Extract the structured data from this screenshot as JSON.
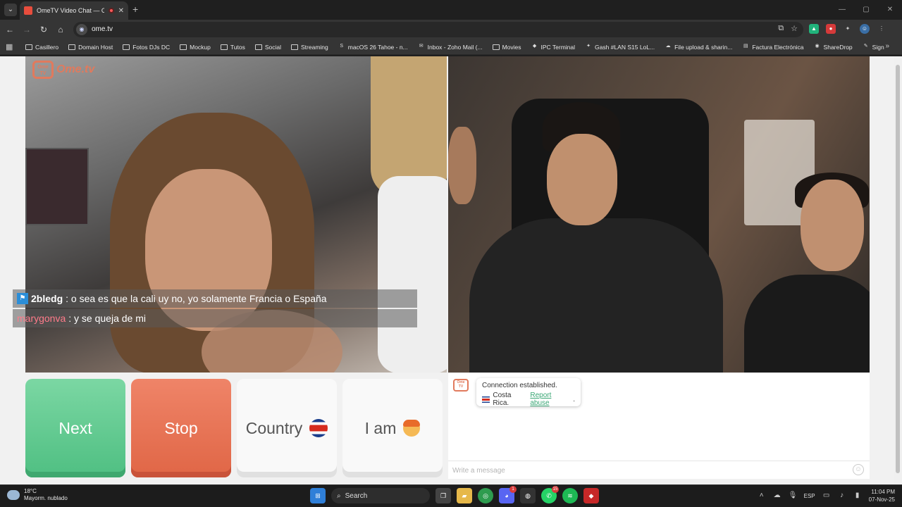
{
  "browser": {
    "tab_title": "OmeTV Video Chat — Ome",
    "url": "ome.tv",
    "window_controls": [
      "—",
      "▢",
      "✕"
    ]
  },
  "bookmarks": [
    {
      "label": "Casillero",
      "icon": "folder-icon"
    },
    {
      "label": "Domain Host",
      "icon": "folder-icon"
    },
    {
      "label": "Fotos DJs DC",
      "icon": "folder-icon"
    },
    {
      "label": "Mockup",
      "icon": "folder-icon"
    },
    {
      "label": "Tutos",
      "icon": "folder-icon"
    },
    {
      "label": "Social",
      "icon": "folder-icon"
    },
    {
      "label": "Streaming",
      "icon": "folder-icon"
    },
    {
      "label": "macOS 26 Tahoe - n...",
      "icon": "s-icon"
    },
    {
      "label": "Inbox - Zoho Mail (...",
      "icon": "mail-icon"
    },
    {
      "label": "Movies",
      "icon": "folder-icon"
    },
    {
      "label": "IPC Terminal",
      "icon": "shield-icon"
    },
    {
      "label": "Gash #LAN S15 LoL...",
      "icon": "game-icon"
    },
    {
      "label": "File upload & sharin...",
      "icon": "cloud-icon"
    },
    {
      "label": "Factura Electrónica",
      "icon": "doc-icon"
    },
    {
      "label": "ShareDrop",
      "icon": "drop-icon"
    },
    {
      "label": "Sign",
      "icon": "sign-icon"
    }
  ],
  "site": {
    "logo_text": "Ome.tv",
    "logo_badge": "Ome TV"
  },
  "overlay_chat": [
    {
      "user": "2bledg",
      "message": ": o sea es que la cali uy no, yo solamente Francia o España"
    },
    {
      "user": "marygonva",
      "message": ": y se queja de mi"
    }
  ],
  "controls": {
    "next": "Next",
    "stop": "Stop",
    "country": "Country",
    "iam": "I am"
  },
  "chat": {
    "system_message": "Connection established.",
    "country": "Costa Rica.",
    "report": "Report abuse",
    "report_suffix": ".",
    "placeholder": "Write a message"
  },
  "taskbar": {
    "temperature": "18°C",
    "weather": "Mayorm. nublado",
    "search": "Search",
    "language": "ESP",
    "time": "11:04 PM",
    "date": "07-Nov-25",
    "badge_discord": "1",
    "badge_whatsapp": "15"
  },
  "colors": {
    "next": "#5cc88e",
    "stop": "#e8704f",
    "brand": "#e17a5d",
    "link": "#3aa775"
  }
}
